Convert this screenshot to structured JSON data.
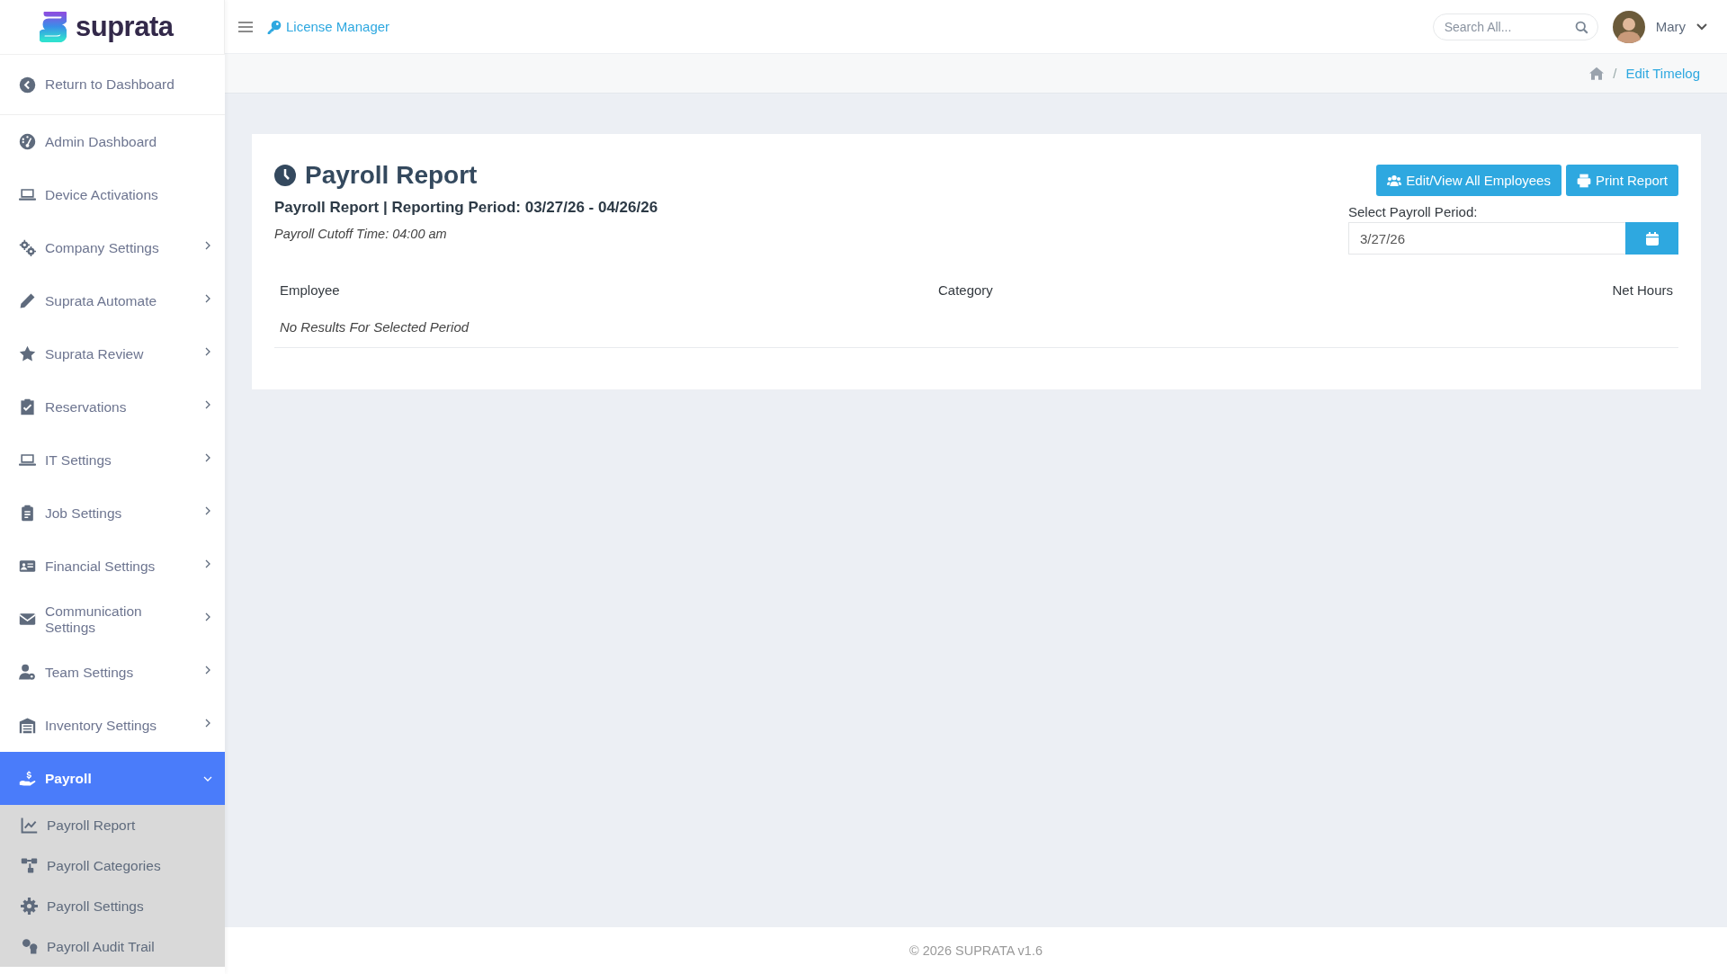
{
  "brand": {
    "name": "suprata"
  },
  "topbar": {
    "link": "License Manager",
    "search": {
      "placeholder": "Search All..."
    },
    "user": {
      "name": "Mary"
    }
  },
  "breadcrumb": {
    "separator": "/",
    "current": "Edit Timelog"
  },
  "sidebar": {
    "back": "Return to Dashboard",
    "items": [
      {
        "label": "Admin Dashboard",
        "submenu": false,
        "selected": false
      },
      {
        "label": "Device Activations",
        "submenu": false,
        "selected": false
      },
      {
        "label": "Company Settings",
        "submenu": true,
        "selected": false
      },
      {
        "label": "Suprata Automate",
        "submenu": true,
        "selected": false
      },
      {
        "label": "Suprata Review",
        "submenu": true,
        "selected": false
      },
      {
        "label": "Reservations",
        "submenu": true,
        "selected": false
      },
      {
        "label": "IT Settings",
        "submenu": true,
        "selected": false
      },
      {
        "label": "Job Settings",
        "submenu": true,
        "selected": false
      },
      {
        "label": "Financial Settings",
        "submenu": true,
        "selected": false
      },
      {
        "label": "Communication Settings",
        "submenu": true,
        "selected": false
      },
      {
        "label": "Team Settings",
        "submenu": true,
        "selected": false
      },
      {
        "label": "Inventory Settings",
        "submenu": true,
        "selected": false
      },
      {
        "label": "Payroll",
        "submenu": true,
        "selected": true,
        "expanded": true,
        "children": [
          {
            "label": "Payroll Report",
            "selected": false
          },
          {
            "label": "Payroll Categories",
            "selected": false
          },
          {
            "label": "Payroll Settings",
            "selected": false
          },
          {
            "label": "Payroll Audit Trail",
            "selected": false
          }
        ]
      }
    ]
  },
  "report": {
    "title": "Payroll Report",
    "subtitle": "Payroll Report | Reporting Period: 03/27/26 - 04/26/26",
    "cutoff": "Payroll Cutoff Time: 04:00 am",
    "buttons": [
      "Edit/View All Employees",
      "Print Report"
    ],
    "period": {
      "label": "Select Payroll Period:",
      "value": "3/27/26"
    },
    "table": {
      "columns": [
        "Employee",
        "Category",
        "Net Hours"
      ],
      "empty": "No Results For Selected Period"
    }
  },
  "footer": "© 2026 SUPRATA v1.6"
}
